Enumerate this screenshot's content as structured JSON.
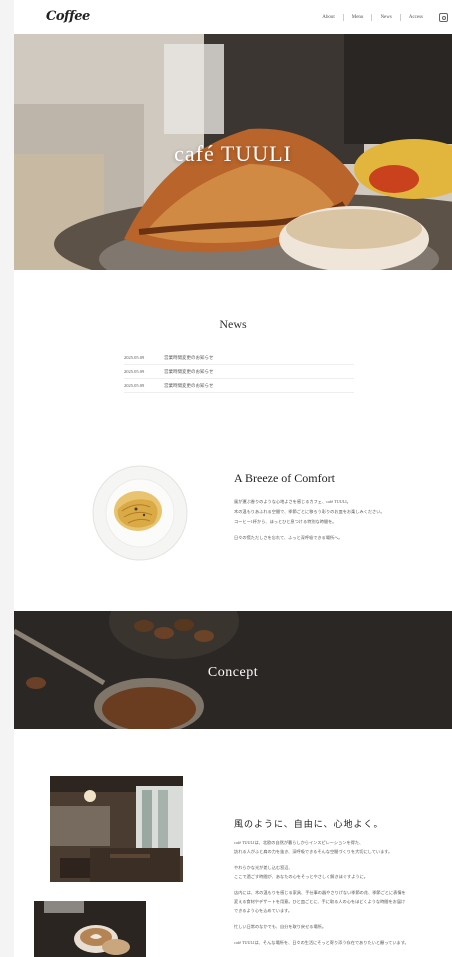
{
  "header": {
    "logo": "Coffee",
    "nav": [
      "About",
      "Menu",
      "News",
      "Access"
    ]
  },
  "hero": {
    "title": "café TUULI"
  },
  "news": {
    "title": "News",
    "items": [
      {
        "date": "2025.05.09",
        "text": "営業時間変更のお知らせ"
      },
      {
        "date": "2025.05.09",
        "text": "営業時間変更のお知らせ"
      },
      {
        "date": "2025.05.09",
        "text": "営業時間変更のお知らせ"
      }
    ]
  },
  "breeze": {
    "title": "A Breeze of Comfort",
    "lines": [
      "風が運ぶ香りのような心地よさを感じるカフェ、café TUULI。",
      "木の温もりあふれる空間で、季節ごとに移ろう彩りのお皿をお楽しみください。",
      "コーヒー1杯から、ほっとひと息つける特別な時間を。",
      "日々の慌ただしさを忘れて、ふっと深呼吸できる場所へ。"
    ]
  },
  "concept": {
    "title": "Concept"
  },
  "wind": {
    "title": "風のように、自由に、心地よく。",
    "lines": [
      "café TUULIは、北欧の自然が暮らしからインスピレーションを得た、",
      "訪れる人がふと肩の力を抜き、深呼吸できるそんな空間づくりを大切にしています。",
      "やわらかな光が差し込む窓辺、",
      "ここで過ごす時間が、あなたの心をそっとやさしく解きほぐすように。",
      "店内には、木の温もりを感じる家具、手仕事の器やさりげない季節の花、季節ごとに表情を",
      "変える食材やデザートを用意。ひと皿ごとに、手に取る人の心をほどくような時間をお届け",
      "できるよう心を込めています。",
      "忙しい日常のなかでも、自分を取り戻せる場所。",
      "café TUULIは、そんな場所を、日々の生活にそっと寄り添う存在でありたいと願っています。"
    ]
  },
  "colors": {
    "background": "#f4f4f4",
    "text": "#333333",
    "accent": "#ffffff"
  }
}
